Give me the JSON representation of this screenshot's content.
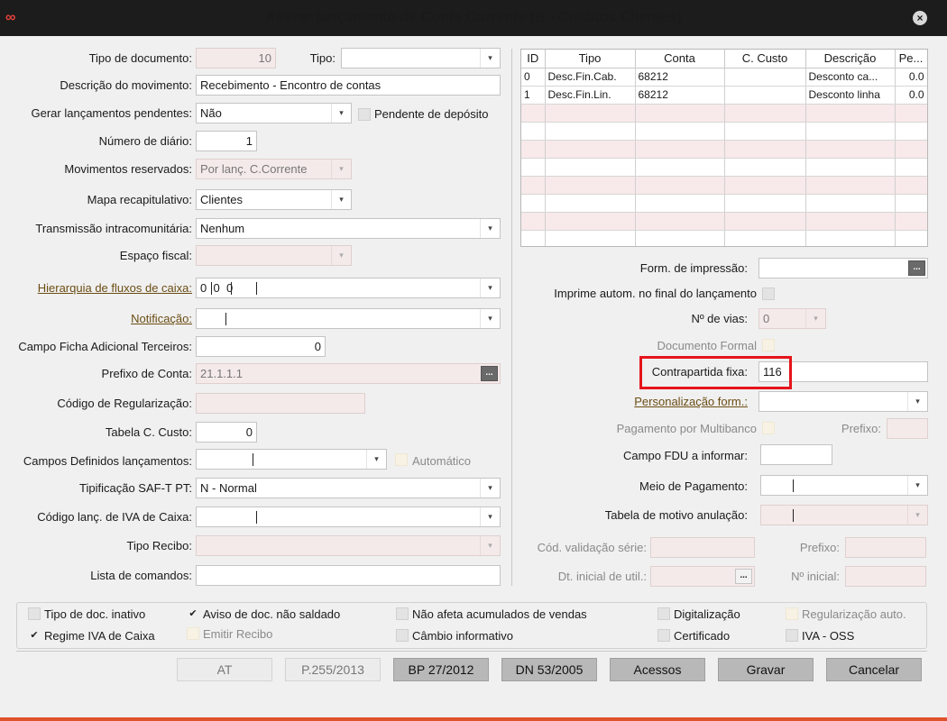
{
  "window": {
    "title": "Alterar lançamento de Conta Corrente (B - Créditos Clientes)",
    "app_icon": "∞",
    "close_icon": "×"
  },
  "left": {
    "tipo_documento": {
      "label": "Tipo de documento:",
      "value": "10"
    },
    "tipo": {
      "label": "Tipo:",
      "value": ""
    },
    "descricao": {
      "label": "Descrição do movimento:",
      "value": "Recebimento - Encontro de contas"
    },
    "gerar_pendentes": {
      "label": "Gerar lançamentos pendentes:",
      "value": "Não"
    },
    "pendente_deposito": {
      "label": "Pendente  de depósito",
      "checked": false
    },
    "numero_diario": {
      "label": "Número de diário:",
      "value": "1"
    },
    "movimentos_reservados": {
      "label": "Movimentos reservados:",
      "value": "Por lanç. C.Corrente"
    },
    "mapa_recapitulativo": {
      "label": "Mapa recapitulativo:",
      "value": "Clientes"
    },
    "transmissao": {
      "label": "Transmissão intracomunitária:",
      "value": "Nenhum"
    },
    "espaco_fiscal": {
      "label": "Espaço fiscal:",
      "value": ""
    },
    "hierarquia": {
      "label": "Hierarquia de fluxos de caixa:",
      "v1": "0",
      "v2": "0",
      "v3": "0"
    },
    "notificacao": {
      "label": "Notificação:",
      "value": ""
    },
    "campo_ficha": {
      "label": "Campo Ficha Adicional Terceiros:",
      "value": "0"
    },
    "prefixo_conta": {
      "label": "Prefixo de Conta:",
      "value": "21.1.1.1"
    },
    "codigo_regularizacao": {
      "label": "Código de Regularização:",
      "value": ""
    },
    "tabela_ccusto": {
      "label": "Tabela C. Custo:",
      "value": "0"
    },
    "campos_definidos": {
      "label": "Campos Definidos lançamentos:",
      "value": ""
    },
    "automatico": {
      "label": "Automático",
      "checked": false
    },
    "saft": {
      "label": "Tipificação SAF-T PT:",
      "value": "N - Normal"
    },
    "codigo_iva_caixa": {
      "label": "Código lanç. de IVA de Caixa:",
      "value": ""
    },
    "tipo_recibo": {
      "label": "Tipo Recibo:",
      "value": ""
    },
    "lista_comandos": {
      "label": "Lista de comandos:",
      "value": ""
    }
  },
  "grid": {
    "columns": [
      "ID",
      "Tipo",
      "Conta",
      "C. Custo",
      "Descrição",
      "Pe..."
    ],
    "rows": [
      [
        "0",
        "Desc.Fin.Cab.",
        "68212",
        "",
        "Desconto ca...",
        "0.0"
      ],
      [
        "1",
        "Desc.Fin.Lin.",
        "68212",
        "",
        "Desconto linha",
        "0.0"
      ]
    ]
  },
  "right": {
    "form_impressao": {
      "label": "Form. de impressão:",
      "value": ""
    },
    "imprime_autom": {
      "label": "Imprime autom. no final do lançamento",
      "checked": false
    },
    "n_vias": {
      "label": "Nº de vias:",
      "value": "0"
    },
    "documento_formal": {
      "label": "Documento Formal",
      "checked": false
    },
    "contrapartida": {
      "label": "Contrapartida fixa:",
      "value": "116"
    },
    "personalizacao": {
      "label": "Personalização form.:",
      "value": ""
    },
    "pagamento_multibanco": {
      "label": "Pagamento por Multibanco",
      "checked": false
    },
    "prefixo_mb": {
      "label": "Prefixo:",
      "value": ""
    },
    "campo_fdu": {
      "label": "Campo FDU a informar:",
      "value": ""
    },
    "meio_pagamento": {
      "label": "Meio de Pagamento:",
      "value": ""
    },
    "tabela_motivo": {
      "label": "Tabela de motivo anulação:",
      "value": ""
    },
    "cod_validacao": {
      "label": "Cód. validação série:",
      "value": ""
    },
    "prefixo_serie": {
      "label": "Prefixo:",
      "value": ""
    },
    "dt_inicial": {
      "label": "Dt. inicial de util.:",
      "value": ""
    },
    "n_inicial": {
      "label": "Nº inicial:",
      "value": ""
    }
  },
  "checks": {
    "tipo_inativo": {
      "label": "Tipo de doc. inativo",
      "checked": false
    },
    "aviso_nao_saldado": {
      "label": "Aviso de doc. não saldado",
      "checked": true
    },
    "nao_afeta": {
      "label": "Não afeta acumulados de  vendas",
      "checked": false
    },
    "digitalizacao": {
      "label": "Digitalização",
      "checked": false
    },
    "regularizacao_auto": {
      "label": "Regularização auto.",
      "checked": false
    },
    "regime_iva_caixa": {
      "label": "Regime IVA de Caixa",
      "checked": true
    },
    "emitir_recibo": {
      "label": "Emitir Recibo",
      "checked": false
    },
    "cambio_informativo": {
      "label": "Câmbio informativo",
      "checked": false
    },
    "certificado": {
      "label": "Certificado",
      "checked": false
    },
    "iva_oss": {
      "label": "IVA - OSS",
      "checked": false
    }
  },
  "buttons": {
    "at": "AT",
    "p255": "P.255/2013",
    "bp27": "BP 27/2012",
    "dn53": "DN 53/2005",
    "acessos": "Acessos",
    "gravar": "Gravar",
    "cancelar": "Cancelar"
  },
  "icons": {
    "dropdown": "▾",
    "dots": "...",
    "check": "✔"
  },
  "colors": {
    "titlebar": "#1c1c1c",
    "highlight": "#e6141b",
    "accent_bottom": "#e0522c",
    "link": "#6b4d14",
    "readonly_bg": "#f5eaea"
  }
}
